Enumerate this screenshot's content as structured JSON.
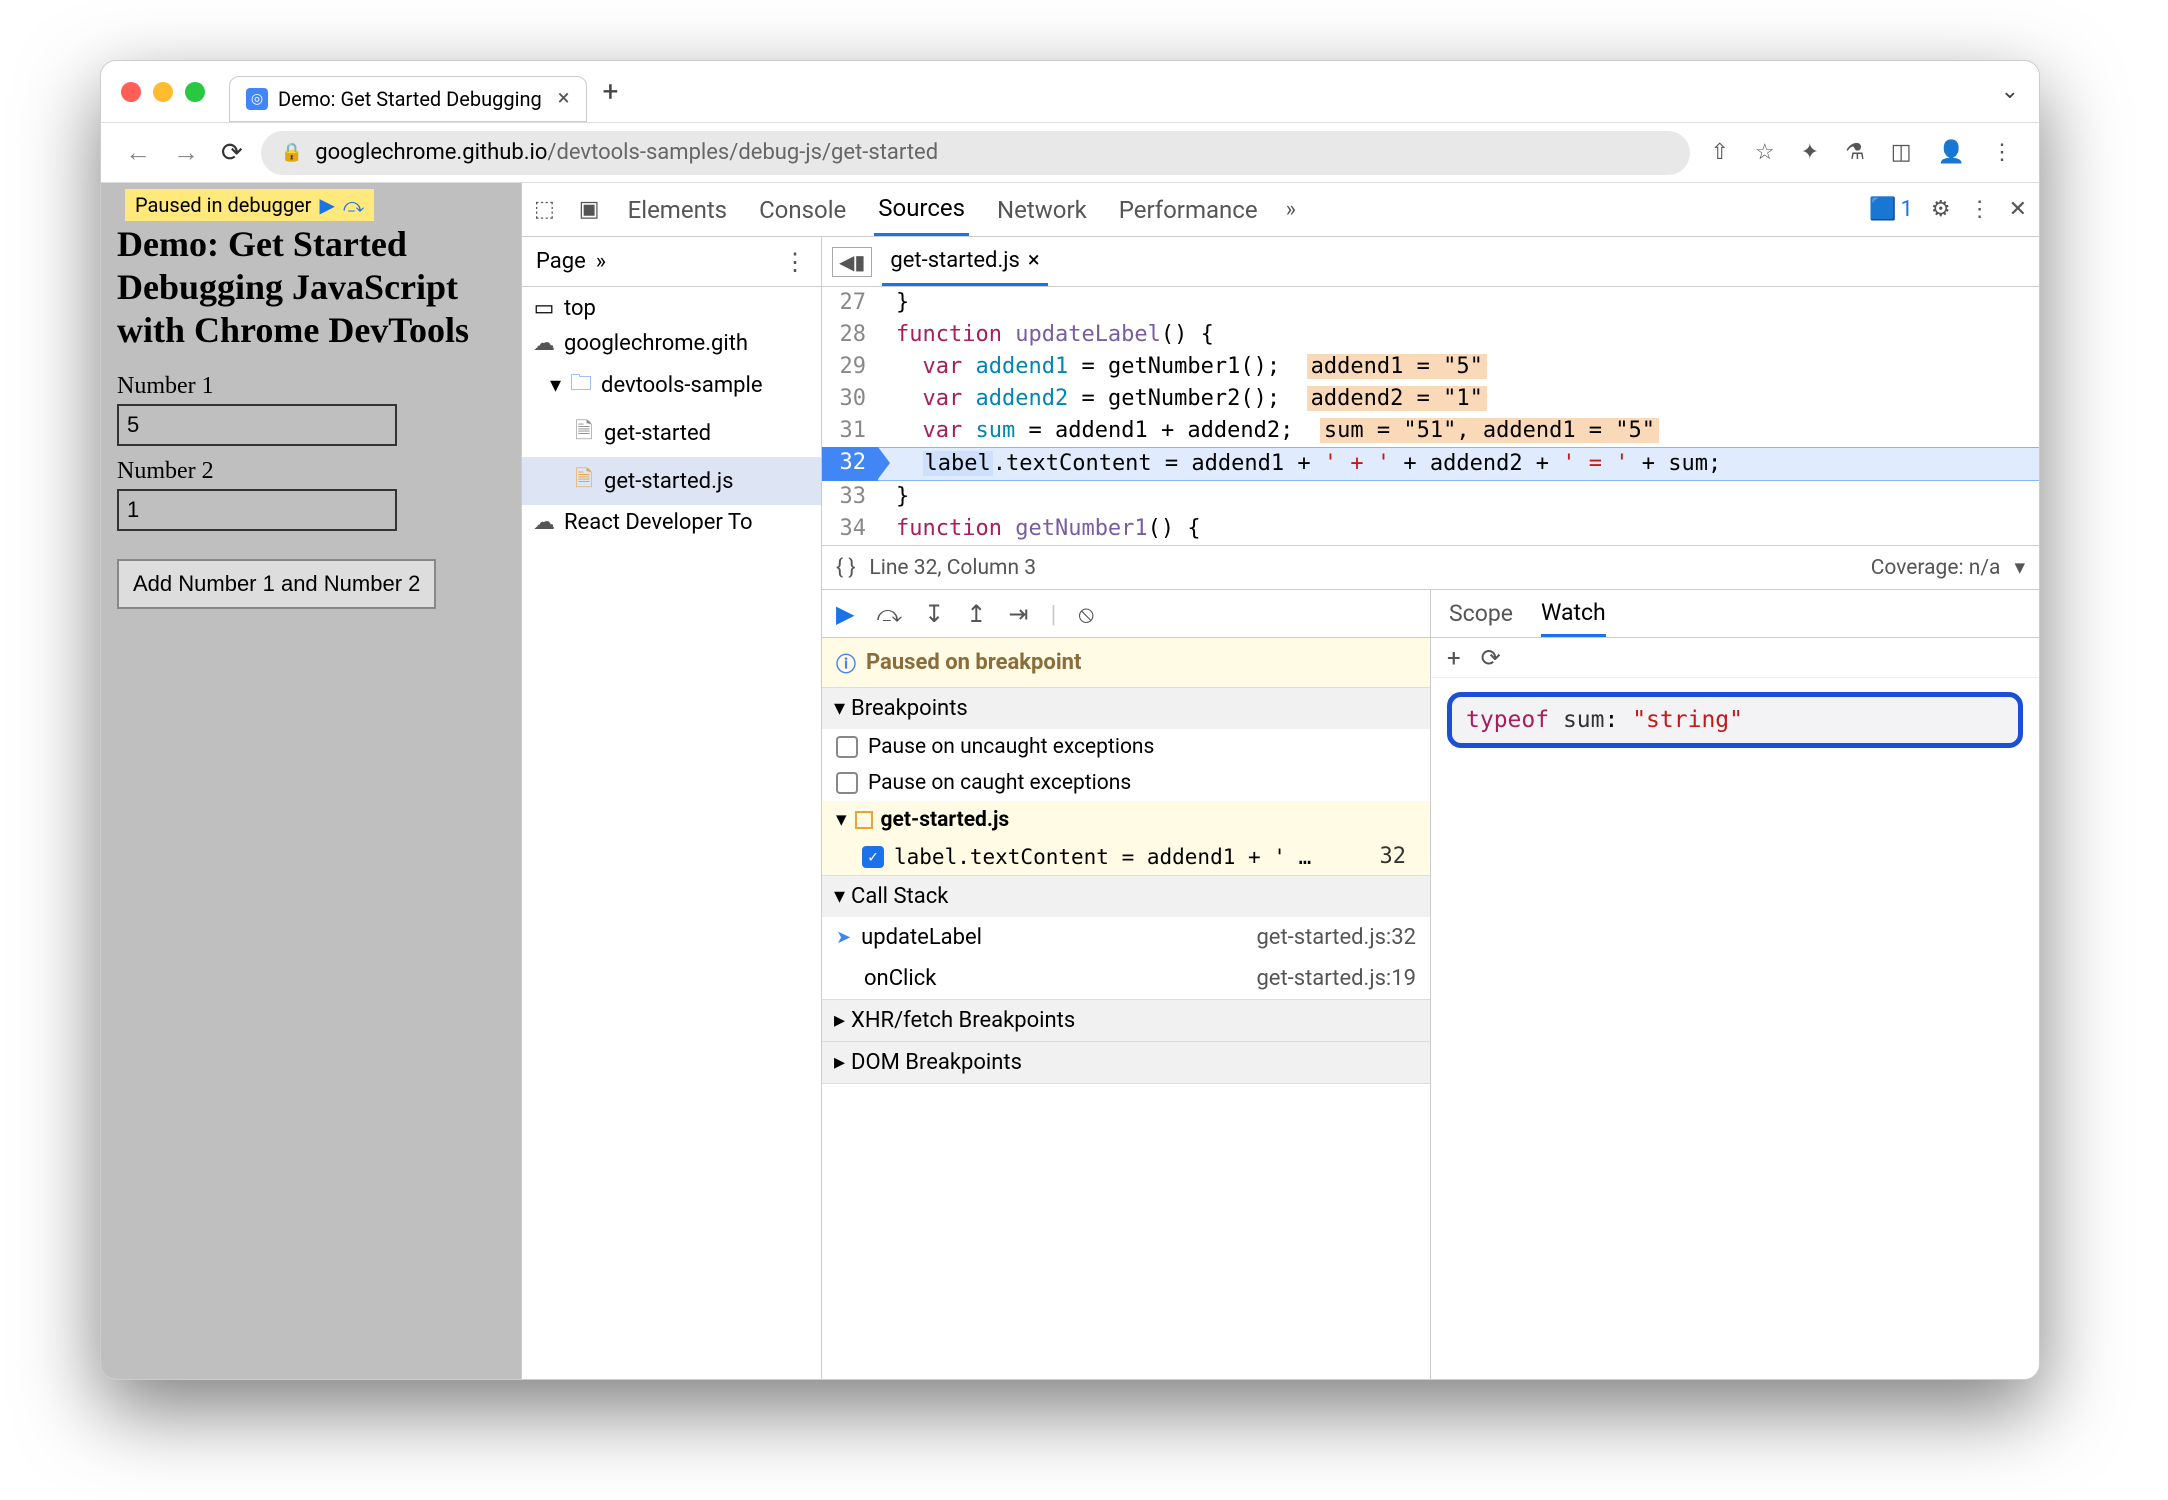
{
  "browser": {
    "tab_title": "Demo: Get Started Debugging",
    "url_host": "googlechrome.github.io",
    "url_path": "/devtools-samples/debug-js/get-started"
  },
  "page": {
    "paused_label": "Paused in debugger",
    "heading": "Demo: Get Started Debugging JavaScript with Chrome DevTools",
    "num1_label": "Number 1",
    "num1_value": "5",
    "num2_label": "Number 2",
    "num2_value": "1",
    "button_label": "Add Number 1 and Number 2"
  },
  "devtools": {
    "tabs": {
      "elements": "Elements",
      "console": "Console",
      "sources": "Sources",
      "network": "Network",
      "performance": "Performance"
    },
    "issues_count": "1",
    "navigator": {
      "head": "Page",
      "top": "top",
      "domain": "googlechrome.gith",
      "folder": "devtools-sample",
      "file_html": "get-started",
      "file_js": "get-started.js",
      "ext": "React Developer To"
    },
    "editor": {
      "tab": "get-started.js",
      "lines": {
        "27": {
          "ln": "27",
          "code": "}"
        },
        "28": {
          "ln": "28",
          "kw1": "function",
          "fn": "updateLabel",
          "rest": "() {"
        },
        "29": {
          "ln": "29",
          "kw": "var",
          "v": "addend1",
          "call": " = getNumber1();",
          "hint": "addend1 = \"5\""
        },
        "30": {
          "ln": "30",
          "kw": "var",
          "v": "addend2",
          "call": " = getNumber2();",
          "hint": "addend2 = \"1\""
        },
        "31": {
          "ln": "31",
          "kw": "var",
          "v": "sum",
          "call": " = addend1 + addend2;",
          "hint": "sum = \"51\", addend1 = \"5\""
        },
        "32": {
          "ln": "32",
          "lbl": "label",
          "rest1": ".textContent = addend1 + ",
          "s1": "' + '",
          "rest2": " + addend2 + ",
          "s2": "' = '",
          "rest3": " + sum;"
        },
        "33": {
          "ln": "33",
          "code": "}"
        },
        "34": {
          "ln": "34",
          "kw1": "function",
          "fn": "getNumber1",
          "rest": "() {"
        }
      },
      "status_pos": "Line 32, Column 3",
      "status_cov": "Coverage: n/a"
    },
    "debugger": {
      "pause_message": "Paused on breakpoint",
      "sections": {
        "breakpoints": "Breakpoints",
        "uncaught": "Pause on uncaught exceptions",
        "caught": "Pause on caught exceptions",
        "bp_file": "get-started.js",
        "bp_code": "label.textContent = addend1 + ' …",
        "bp_line": "32",
        "callstack": "Call Stack",
        "cs1_fn": "updateLabel",
        "cs1_loc": "get-started.js:32",
        "cs2_fn": "onClick",
        "cs2_loc": "get-started.js:19",
        "xhr": "XHR/fetch Breakpoints",
        "dom": "DOM Breakpoints"
      },
      "scope_tab": "Scope",
      "watch_tab": "Watch",
      "watch": {
        "expr": "typeof",
        "name": "sum",
        "val": "\"string\""
      }
    }
  }
}
